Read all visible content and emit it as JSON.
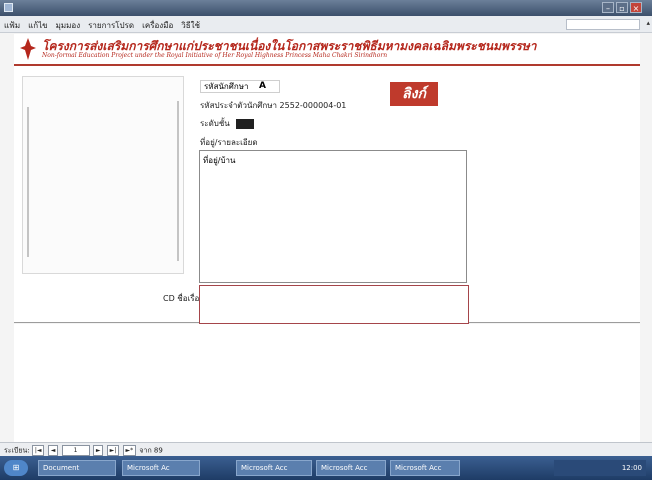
{
  "window": {
    "title": "",
    "buttons": [
      "–",
      "▫",
      "×"
    ]
  },
  "menu": {
    "items": [
      "แฟ้ม",
      "แก้ไข",
      "มุมมอง",
      "รายการโปรด",
      "เครื่องมือ",
      "วิธีใช้"
    ]
  },
  "banner": {
    "title": "โครงการส่งเสริมการศึกษาแก่ประชาชนเนื่องในโอกาสพระราชพิธีมหามงคลเฉลิมพระชนมพรรษา",
    "subtitle": "Non-formal Education Project under the Royal Initiative of Her Royal Highness Princess Maha Chakri Sirindhorn"
  },
  "record": {
    "pill_label": "รหัสนักศึกษา",
    "pill_mark": "A",
    "chip_text": "ลิงก์",
    "id_label": "รหัสประจำตัวนักศึกษา",
    "id_value": "2552-000004-01",
    "class_label": "ระดับชั้น",
    "address_label": "ที่อยู่/รายละเอียด",
    "address_value": "ที่อยู่/บ้าน",
    "cd_label": "CD ชื่อเรื่อง"
  },
  "statusbar": {
    "record_label": "ระเบียน:",
    "nav_first": "|◄",
    "nav_prev": "◄",
    "record_num": "1",
    "nav_next": "►",
    "nav_last": "►|",
    "nav_new": "►*",
    "of_text": "จาก 89"
  },
  "taskbar": {
    "start": "⊞",
    "tasks": [
      "Document",
      "Microsoft Ac",
      "Microsoft Acc",
      "Microsoft Acc",
      "Microsoft Acc"
    ],
    "clock": "12:00"
  },
  "colors": {
    "brand_red": "#bf3a2c",
    "titlebar": "#3c4f6b",
    "taskbar": "#1e3c66"
  }
}
